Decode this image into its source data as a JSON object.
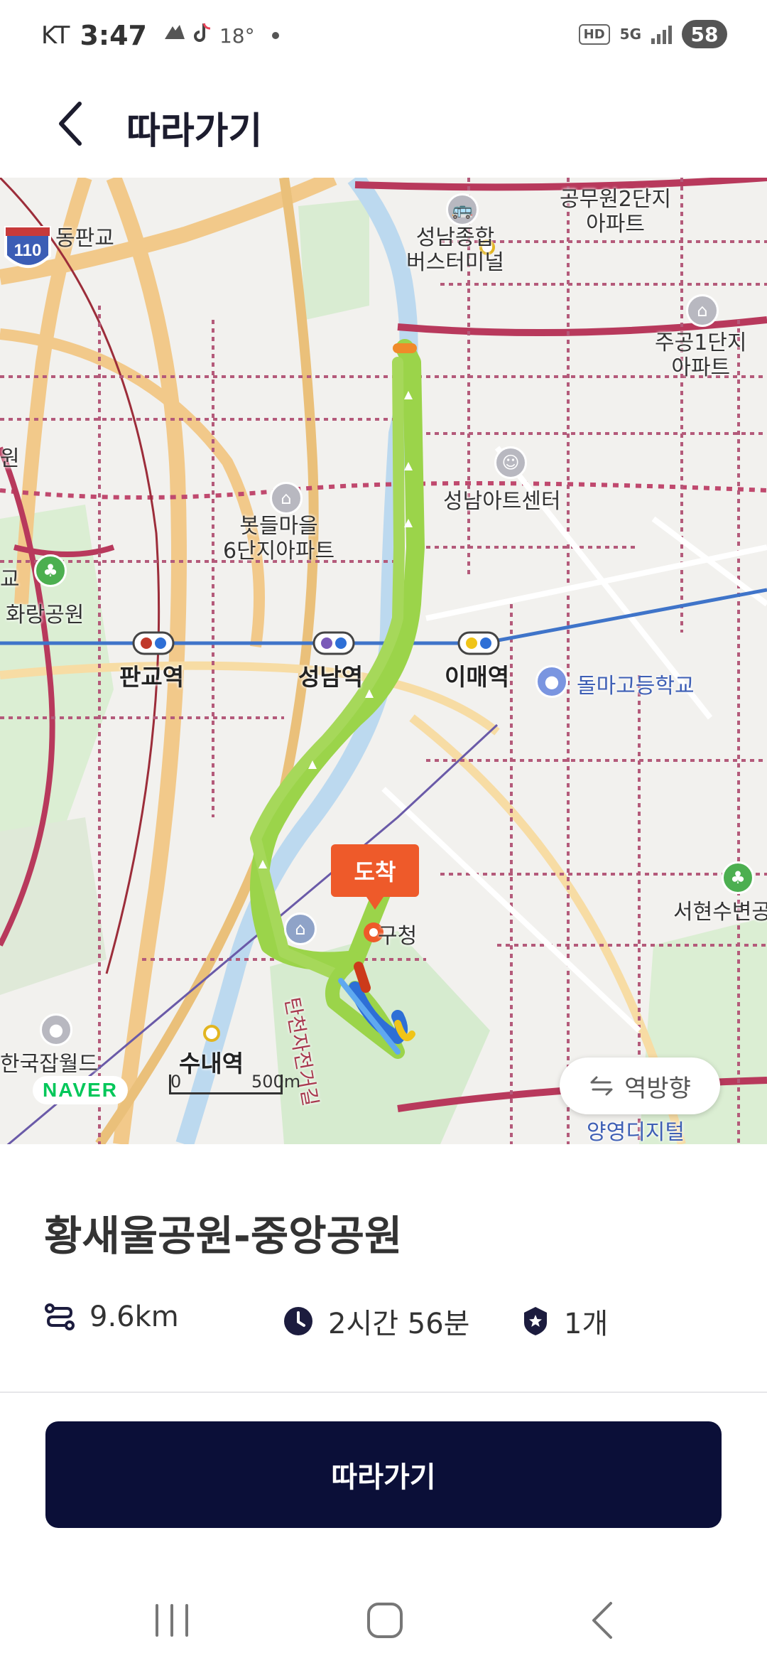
{
  "status_bar": {
    "carrier": "KT",
    "time": "3:47",
    "temperature": "18°",
    "network": "5G",
    "hd": "HD",
    "battery": "58"
  },
  "header": {
    "title": "따라가기",
    "back_icon": "chevron-left-icon"
  },
  "map": {
    "labels": {
      "dongpangyo": "동판교",
      "highway": "110",
      "gongmuwon": "공무원2단지\n아파트",
      "seongnam_terminal": "성남종합\n버스터미널",
      "jugong": "주공1단지\n아파트",
      "art_center": "성남아트센터",
      "bongdeul": "봇들마을\n6단지아파트",
      "hwarang": "화랑공원",
      "pangyo_station": "판교역",
      "seongnam_station": "성남역",
      "imae_station": "이매역",
      "dolma_school": "돌마고등학교",
      "seohyeon": "서현수변공",
      "hanguk": "한국잡월드",
      "sunae_station": "수내역",
      "tancheon": "탄천자전거길",
      "district_office": "구청",
      "yangyeong": "양영디지털",
      "left_edge_1": "원",
      "left_edge_2": "교"
    },
    "arrive_label": "도착",
    "naver_logo": "NAVER",
    "scale_zero": "0",
    "scale_distance": "500m",
    "reverse_button": "역방향",
    "route_color": "#9bd44a",
    "accent_color": "#ee5a2a"
  },
  "course": {
    "name": "황새울공원-중앙공원",
    "distance": "9.6km",
    "duration": "2시간 56분",
    "stamps": "1개",
    "icons": {
      "distance": "route-icon",
      "duration": "clock-icon",
      "stamps": "badge-icon"
    }
  },
  "actions": {
    "follow_button": "따라가기",
    "button_color": "#0b0f38"
  },
  "nav_bar": {
    "recents": "recents-icon",
    "home": "home-icon",
    "back": "back-icon"
  }
}
